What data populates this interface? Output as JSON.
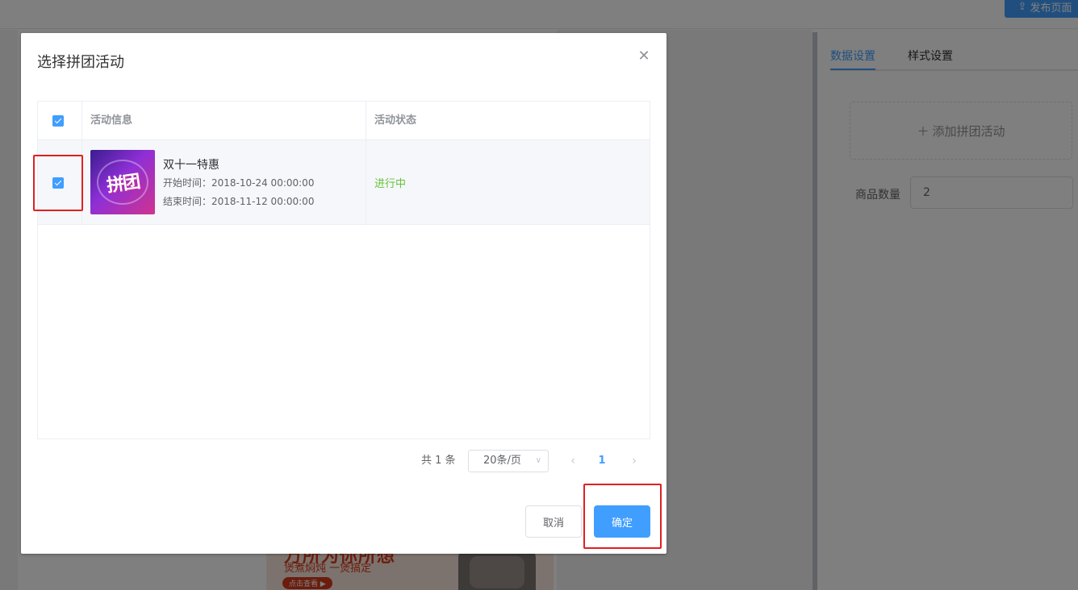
{
  "topbar": {
    "publish_label": "发布页面",
    "publish_icon": "upload-icon"
  },
  "preview": {
    "banner_title": "万所为你所想",
    "banner_subtitle": "煲煮焖炖 一煲搞定",
    "banner_button": "点击查看 ▶"
  },
  "settings": {
    "tabs": [
      {
        "label": "数据设置",
        "active": true
      },
      {
        "label": "样式设置",
        "active": false
      }
    ],
    "add_label": "添加拼团活动",
    "qty_label": "商品数量",
    "qty_value": "2"
  },
  "dialog": {
    "title": "选择拼团活动",
    "columns": {
      "info": "活动信息",
      "status": "活动状态"
    },
    "rows": [
      {
        "checked": true,
        "thumb_text": "拼团",
        "name": "双十一特惠",
        "start": "开始时间：2018-10-24 00:00:00",
        "end": "结束时间：2018-11-12 00:00:00",
        "status": "进行中"
      }
    ],
    "pagination": {
      "total": "共 1 条",
      "page_size": "20条/页",
      "current_page": "1"
    },
    "cancel_label": "取消",
    "confirm_label": "确定"
  },
  "colors": {
    "primary": "#409eff",
    "success": "#67c23a",
    "highlight": "#e02020"
  }
}
